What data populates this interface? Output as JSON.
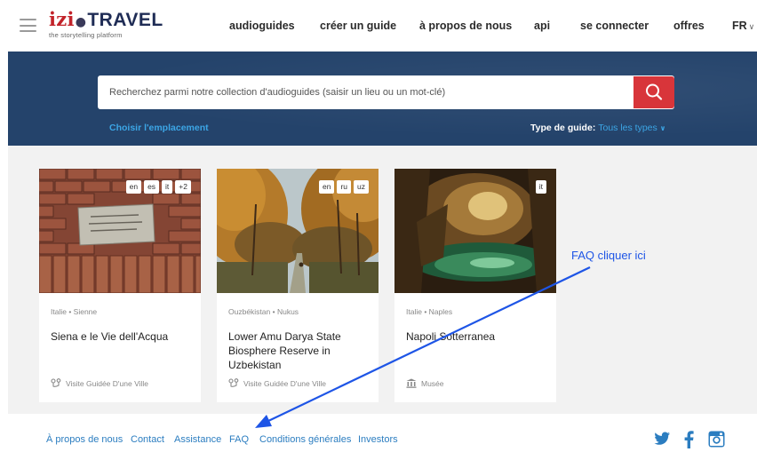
{
  "header": {
    "logo_main": "izi",
    "logo_travel": "TRAVEL",
    "logo_tagline": "the storytelling platform",
    "nav": [
      "audioguides",
      "créer un guide",
      "à propos de nous",
      "api",
      "se connecter",
      "offres"
    ],
    "language": "FR"
  },
  "search": {
    "placeholder": "Recherchez parmi notre collection d'audioguides (saisir un lieu ou un mot-clé)",
    "choose_location": "Choisir l'emplacement",
    "guide_type_label": "Type de guide:",
    "guide_type_value": "Tous les types"
  },
  "cards": [
    {
      "languages": [
        "en",
        "es",
        "it",
        "+2"
      ],
      "location": "Italie • Sienne",
      "title": "Siena e le Vie dell'Acqua",
      "type": "Visite Guidée D'une Ville",
      "type_icon": "route-icon"
    },
    {
      "languages": [
        "en",
        "ru",
        "uz"
      ],
      "location": "Ouzbékistan • Nukus",
      "title": "Lower Amu Darya State Biosphere Reserve in Uzbekistan",
      "type": "Visite Guidée D'une Ville",
      "type_icon": "route-icon"
    },
    {
      "languages": [
        "it"
      ],
      "location": "Italie • Naples",
      "title": "Napoli Sotterranea",
      "type": "Musée",
      "type_icon": "museum-icon"
    }
  ],
  "annotation": {
    "text": "FAQ cliquer ici",
    "color": "#1e55e6"
  },
  "footer": {
    "links": [
      "À propos de nous",
      "Contact",
      "Assistance",
      "FAQ",
      "Conditions générales",
      "Investors"
    ],
    "social": [
      "twitter-icon",
      "facebook-icon",
      "instagram-icon"
    ]
  },
  "colors": {
    "brand_red": "#c2232a",
    "hero_bg": "#24436b",
    "link_blue": "#2b7dc0",
    "accent_blue": "#3ca6e6"
  }
}
